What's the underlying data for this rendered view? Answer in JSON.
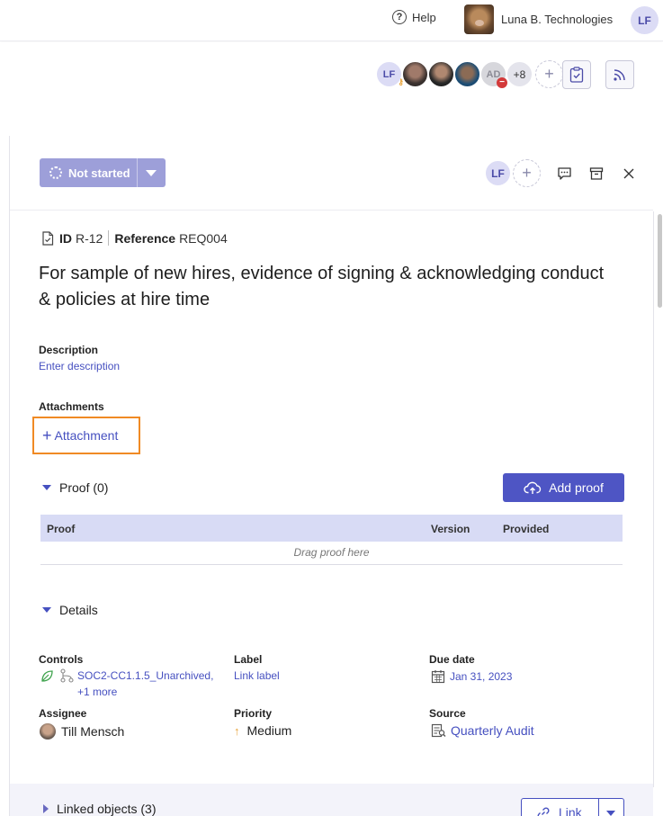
{
  "topbar": {
    "help_label": "Help",
    "org_name": "Luna B. Technologies",
    "user_initials": "LF"
  },
  "collaborators": {
    "first_initials": "LF",
    "ad_initials": "AD",
    "more_count": "+8",
    "add_symbol": "+"
  },
  "panel": {
    "status_label": "Not started",
    "assignee_initials": "LF",
    "add_symbol": "+"
  },
  "requirement": {
    "id_label": "ID",
    "id_value": "R-12",
    "reference_label": "Reference",
    "reference_value": "REQ004",
    "title": "For sample of new hires, evidence of signing & acknowledging conduct & policies at hire time"
  },
  "description": {
    "label": "Description",
    "placeholder": "Enter description"
  },
  "attachments": {
    "label": "Attachments",
    "add_label": "Attachment",
    "plus": "+"
  },
  "proof": {
    "section_title": "Proof (0)",
    "add_button": "Add proof",
    "columns": [
      "Proof",
      "Version",
      "Provided"
    ],
    "drop_hint": "Drag proof here"
  },
  "details": {
    "section_title": "Details",
    "controls_label": "Controls",
    "controls_value": "SOC2-CC1.1.5_Unarchived,",
    "controls_more": "+1 more",
    "label_label": "Label",
    "label_value": "Link label",
    "due_label": "Due date",
    "due_value": "Jan 31, 2023",
    "assignee_label": "Assignee",
    "assignee_value": "Till Mensch",
    "priority_label": "Priority",
    "priority_value": "Medium",
    "source_label": "Source",
    "source_value": "Quarterly Audit"
  },
  "linked": {
    "section_title": "Linked objects (3)",
    "link_button": "Link"
  },
  "colors": {
    "accent": "#4e55c4",
    "status_bg": "#9d9fd9",
    "highlight": "#f08a24",
    "priority_arrow": "#e8a33a",
    "leaf": "#3fa34d"
  }
}
